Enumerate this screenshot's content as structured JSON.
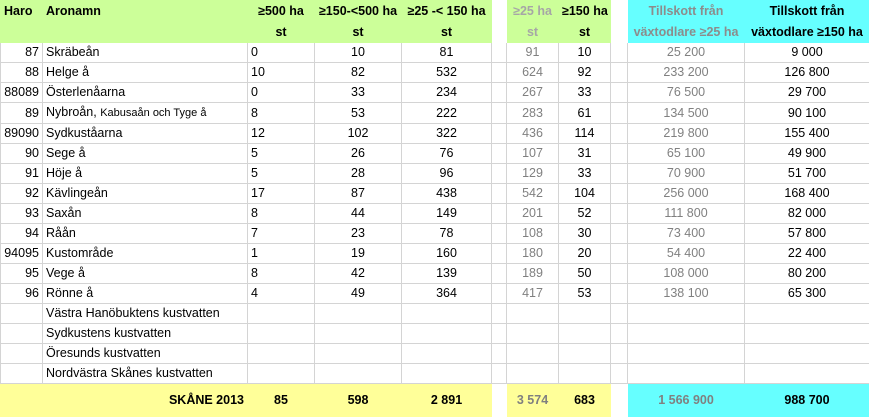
{
  "header": {
    "haro": "Haro",
    "aronamn": "Aronamn",
    "c500_top": "≥500 ha",
    "c500_bot": "st",
    "c150_top": "≥150-<500 ha",
    "c150_bot": "st",
    "c25_top": "≥25 -< 150 ha",
    "c25_bot": "st",
    "g25_top": "≥25 ha",
    "g25_bot": "st",
    "g150_top": "≥150 ha",
    "g150_bot": "st",
    "t25_top": "Tillskott från",
    "t25_bot": "växtodlare ≥25 ha",
    "t150_top": "Tillskott från",
    "t150_bot": "växtodlare ≥150 ha"
  },
  "rows": [
    {
      "haro": "87",
      "name": "Skräbeån",
      "name_small": "",
      "a": "0",
      "b": "10",
      "c": "81",
      "d": "91",
      "e": "10",
      "f": "25 200",
      "g": "9 000"
    },
    {
      "haro": "88",
      "name": "Helge å",
      "name_small": "",
      "a": "10",
      "b": "82",
      "c": "532",
      "d": "624",
      "e": "92",
      "f": "233 200",
      "g": "126 800"
    },
    {
      "haro": "88089",
      "name": "Österlenåarna",
      "name_small": "",
      "a": "0",
      "b": "33",
      "c": "234",
      "d": "267",
      "e": "33",
      "f": "76 500",
      "g": "29 700"
    },
    {
      "haro": "89",
      "name": "Nybroån,",
      "name_small": "Kabusaån och Tyge å",
      "a": "8",
      "b": "53",
      "c": "222",
      "d": "283",
      "e": "61",
      "f": "134 500",
      "g": "90 100"
    },
    {
      "haro": "89090",
      "name": "Sydkuståarna",
      "name_small": "",
      "a": "12",
      "b": "102",
      "c": "322",
      "d": "436",
      "e": "114",
      "f": "219 800",
      "g": "155 400"
    },
    {
      "haro": "90",
      "name": "Sege å",
      "name_small": "",
      "a": "5",
      "b": "26",
      "c": "76",
      "d": "107",
      "e": "31",
      "f": "65 100",
      "g": "49 900"
    },
    {
      "haro": "91",
      "name": "Höje å",
      "name_small": "",
      "a": "5",
      "b": "28",
      "c": "96",
      "d": "129",
      "e": "33",
      "f": "70 900",
      "g": "51 700"
    },
    {
      "haro": "92",
      "name": "Kävlingeån",
      "name_small": "",
      "a": "17",
      "b": "87",
      "c": "438",
      "d": "542",
      "e": "104",
      "f": "256 000",
      "g": "168 400"
    },
    {
      "haro": "93",
      "name": "Saxån",
      "name_small": "",
      "a": "8",
      "b": "44",
      "c": "149",
      "d": "201",
      "e": "52",
      "f": "111 800",
      "g": "82 000"
    },
    {
      "haro": "94",
      "name": "Råån",
      "name_small": "",
      "a": "7",
      "b": "23",
      "c": "78",
      "d": "108",
      "e": "30",
      "f": "73 400",
      "g": "57 800"
    },
    {
      "haro": "94095",
      "name": "Kustområde",
      "name_small": "",
      "a": "1",
      "b": "19",
      "c": "160",
      "d": "180",
      "e": "20",
      "f": "54 400",
      "g": "22 400"
    },
    {
      "haro": "95",
      "name": "Vege å",
      "name_small": "",
      "a": "8",
      "b": "42",
      "c": "139",
      "d": "189",
      "e": "50",
      "f": "108 000",
      "g": "80 200"
    },
    {
      "haro": "96",
      "name": "Rönne å",
      "name_small": "",
      "a": "4",
      "b": "49",
      "c": "364",
      "d": "417",
      "e": "53",
      "f": "138 100",
      "g": "65 300"
    },
    {
      "haro": "",
      "name": "Västra Hanöbuktens kustvatten",
      "name_small": "",
      "a": "",
      "b": "",
      "c": "",
      "d": "",
      "e": "",
      "f": "",
      "g": ""
    },
    {
      "haro": "",
      "name": "Sydkustens kustvatten",
      "name_small": "",
      "a": "",
      "b": "",
      "c": "",
      "d": "",
      "e": "",
      "f": "",
      "g": ""
    },
    {
      "haro": "",
      "name": "Öresunds kustvatten",
      "name_small": "",
      "a": "",
      "b": "",
      "c": "",
      "d": "",
      "e": "",
      "f": "",
      "g": ""
    },
    {
      "haro": "",
      "name": "Nordvästra Skånes kustvatten",
      "name_small": "",
      "a": "",
      "b": "",
      "c": "",
      "d": "",
      "e": "",
      "f": "",
      "g": ""
    }
  ],
  "total": {
    "label": "SKÅNE 2013",
    "a": "85",
    "b": "598",
    "c": "2 891",
    "d": "3 574",
    "e": "683",
    "f": "1 566 900",
    "g": "988 700"
  }
}
